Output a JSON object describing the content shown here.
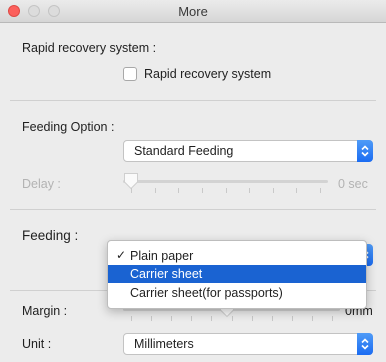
{
  "window": {
    "title": "More"
  },
  "rapid_recovery": {
    "section_label": "Rapid recovery system :",
    "checkbox_label": "Rapid recovery system",
    "checked": false
  },
  "feeding_option": {
    "label": "Feeding Option :",
    "selected": "Standard Feeding"
  },
  "delay": {
    "label": "Delay :",
    "value_text": "0 sec",
    "enabled": false,
    "value": 0
  },
  "feeding": {
    "label": "Feeding :",
    "options": [
      {
        "label": "Plain paper",
        "checked": true,
        "highlighted": false
      },
      {
        "label": "Carrier sheet",
        "checked": false,
        "highlighted": true
      },
      {
        "label": "Carrier sheet(for passports)",
        "checked": false,
        "highlighted": false
      }
    ]
  },
  "margin": {
    "label": "Margin :",
    "value_text": "0mm"
  },
  "unit": {
    "label": "Unit :",
    "selected": "Millimeters"
  },
  "colors": {
    "accent": "#1a63d2",
    "close_button": "#fc605c"
  }
}
